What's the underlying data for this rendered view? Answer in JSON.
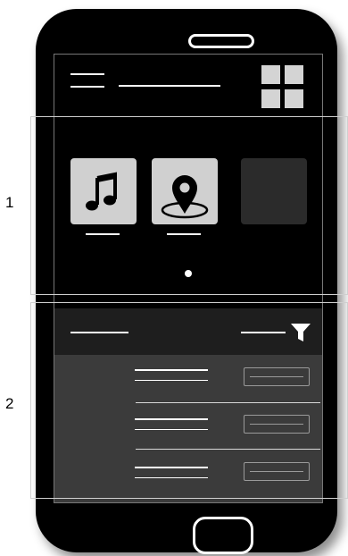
{
  "sections": [
    {
      "number": "1"
    },
    {
      "number": "2"
    }
  ],
  "carousel": {
    "apps": [
      {
        "icon": "music-note-icon"
      },
      {
        "icon": "location-pin-icon"
      },
      {
        "icon": "empty-tile"
      }
    ],
    "page_indicator_count": 1
  },
  "list": {
    "row_count": 3
  },
  "icons": [
    "hamburger-menu-icon",
    "grid-icon",
    "music-note-icon",
    "location-pin-icon",
    "filter-icon"
  ]
}
